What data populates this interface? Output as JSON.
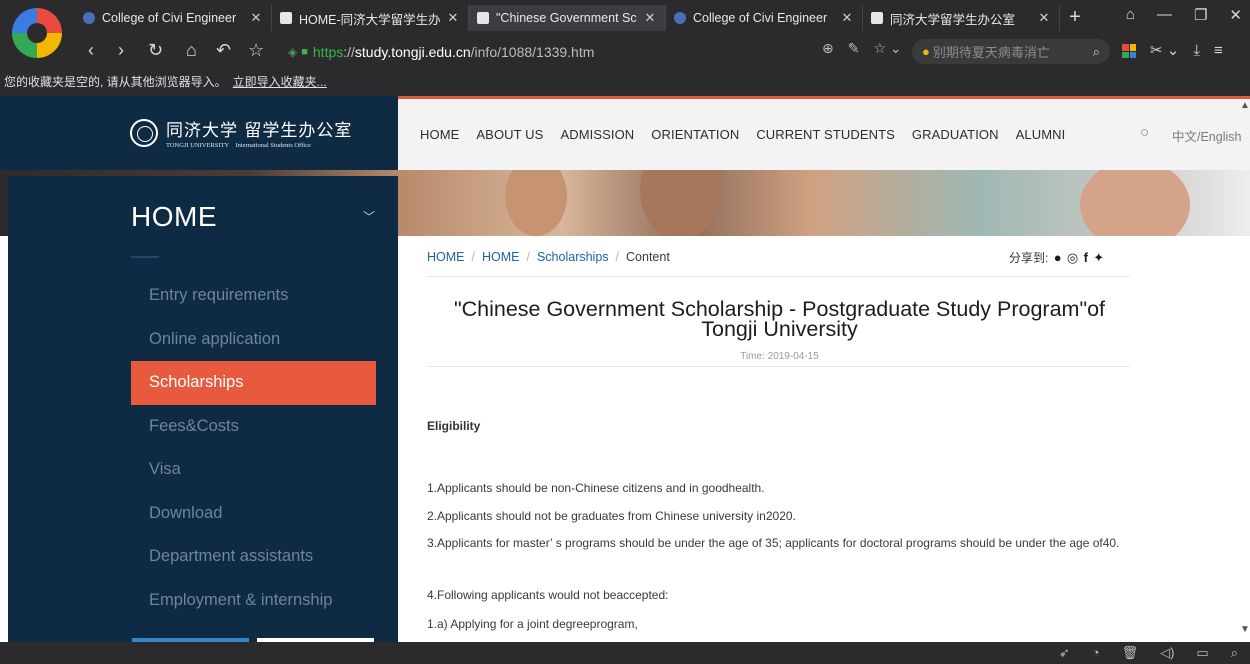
{
  "browser": {
    "tabs": [
      {
        "title": "College of Civi Engineer",
        "icon": "globe",
        "active": false
      },
      {
        "title": "HOME-同济大学留学生办",
        "icon": "doc",
        "active": false
      },
      {
        "title": "\"Chinese Government Sc",
        "icon": "doc",
        "active": true
      },
      {
        "title": "College of Civi Engineer",
        "icon": "globe",
        "active": false
      },
      {
        "title": "同济大学留学生办公室",
        "icon": "doc",
        "active": false
      }
    ],
    "url": {
      "protocol": "https",
      "separator": "://",
      "host": "study.tongji.edu.cn",
      "path": "/info/1088/1339.htm"
    },
    "search_placeholder": "别期待夏天病毒消亡",
    "bookmarks_bar": {
      "text": "您的收藏夹是空的, 请从其他浏览器导入。",
      "link": "立即导入收藏夹..."
    }
  },
  "site": {
    "brand_cn": "同济大学 留学生办公室",
    "brand_en_left": "TONGJI UNIVERSITY",
    "brand_en_right": "International Students Office",
    "nav": [
      "HOME",
      "ABOUT US",
      "ADMISSION",
      "ORIENTATION",
      "CURRENT STUDENTS",
      "GRADUATION",
      "ALUMNI"
    ],
    "lang_switch": "中文/English"
  },
  "sidebar": {
    "title": "HOME",
    "items": [
      {
        "label": "Entry requirements",
        "active": false
      },
      {
        "label": "Online application",
        "active": false
      },
      {
        "label": "Scholarships",
        "active": true
      },
      {
        "label": "Fees&Costs",
        "active": false
      },
      {
        "label": "Visa",
        "active": false
      },
      {
        "label": "Download",
        "active": false
      },
      {
        "label": "Department assistants",
        "active": false
      },
      {
        "label": "Employment & internship",
        "active": false
      }
    ]
  },
  "breadcrumb": [
    "HOME",
    "HOME",
    "Scholarships",
    "Content"
  ],
  "share_label": "分享到:",
  "article": {
    "title": "\"Chinese Government Scholarship - Postgraduate Study Program\"of Tongji University",
    "time": "Time: 2019-04-15",
    "heading": "Eligibility",
    "paragraphs": [
      "1.Applicants should be non-Chinese citizens and in goodhealth.",
      "2.Applicants should not be graduates from Chinese university in2020.",
      "3.Applicants for master’ s programs should be under the age of 35; applicants for doctoral programs should be under the age of40.",
      "4.Following applicants would not beaccepted:",
      "1.a) Applying for a joint degreeprogram,"
    ]
  },
  "colors": {
    "navy": "#0f2a43",
    "accent": "#e85a3d",
    "link": "#2360a6"
  }
}
